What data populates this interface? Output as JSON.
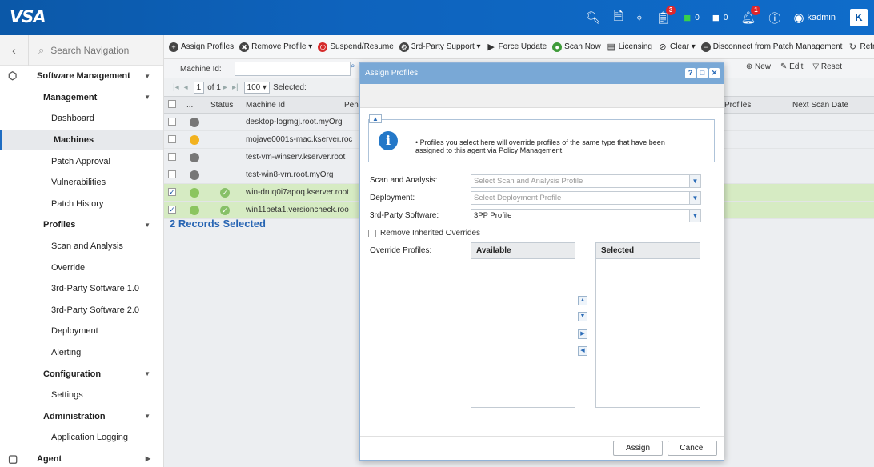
{
  "app": {
    "logo": "VSA",
    "notifications": {
      "tickets": "3",
      "alerts": "1"
    },
    "agents_online": "0",
    "agents_offline": "0",
    "user": "kadmin",
    "brand_letter": "K"
  },
  "sidebar": {
    "search_placeholder": "Search Navigation",
    "items": [
      {
        "label": "Software Management",
        "level": 0
      },
      {
        "label": "Management",
        "level": 1
      },
      {
        "label": "Dashboard",
        "level": 2
      },
      {
        "label": "Machines",
        "level": 2
      },
      {
        "label": "Patch Approval",
        "level": 2
      },
      {
        "label": "Vulnerabilities",
        "level": 2
      },
      {
        "label": "Patch History",
        "level": 2
      },
      {
        "label": "Profiles",
        "level": 1
      },
      {
        "label": "Scan and Analysis",
        "level": 2
      },
      {
        "label": "Override",
        "level": 2
      },
      {
        "label": "3rd-Party Software 1.0",
        "level": 2
      },
      {
        "label": "3rd-Party Software 2.0",
        "level": 2
      },
      {
        "label": "Deployment",
        "level": 2
      },
      {
        "label": "Alerting",
        "level": 2
      },
      {
        "label": "Configuration",
        "level": 1
      },
      {
        "label": "Settings",
        "level": 2
      },
      {
        "label": "Administration",
        "level": 1
      },
      {
        "label": "Application Logging",
        "level": 2
      },
      {
        "label": "Agent",
        "level": 0
      }
    ]
  },
  "toolbar": {
    "assign_profiles": "Assign Profiles",
    "remove_profile": "Remove Profile",
    "suspend_resume": "Suspend/Resume",
    "third_party_support": "3rd-Party Support",
    "force_update": "Force Update",
    "scan_now": "Scan Now",
    "licensing": "Licensing",
    "clear": "Clear",
    "disconnect": "Disconnect from Patch Management",
    "refresh": "Refresh"
  },
  "filter": {
    "machine_id_label": "Machine Id:",
    "new": "New",
    "edit": "Edit",
    "reset": "Reset"
  },
  "pager": {
    "page": "1",
    "of": "of 1",
    "page_size": "100",
    "selected_label": "Selected:"
  },
  "grid": {
    "headers": {
      "more": "...",
      "status": "Status",
      "machine_id": "Machine Id",
      "pending": "Pend",
      "profiles": "Profiles",
      "next_scan": "Next Scan Date"
    },
    "rows": [
      {
        "machine": "desktop-logmgj.root.myOrg",
        "checked": false,
        "status": "gray",
        "override": false
      },
      {
        "machine": "mojave0001s-mac.kserver.roc",
        "checked": false,
        "status": "yellow",
        "override": false
      },
      {
        "machine": "test-vm-winserv.kserver.root",
        "checked": false,
        "status": "gray",
        "override": false
      },
      {
        "machine": "test-win8-vm.root.myOrg",
        "checked": false,
        "status": "gray",
        "override": false
      },
      {
        "machine": "win-druq0i7apoq.kserver.root",
        "checked": true,
        "status": "green",
        "override": true
      },
      {
        "machine": "win11beta1.versioncheck.roo",
        "checked": true,
        "status": "green",
        "override": true
      }
    ],
    "records_selected": "2 Records Selected"
  },
  "modal": {
    "title": "Assign Profiles",
    "info": "Profiles you select here will override profiles of the same type that have been assigned to this agent via Policy Management.",
    "scan_label": "Scan and Analysis:",
    "scan_placeholder": "Select Scan and Analysis Profile",
    "deploy_label": "Deployment:",
    "deploy_placeholder": "Select Deployment Profile",
    "tps_label": "3rd-Party Software:",
    "tps_value": "3PP Profile",
    "remove_inherited": "Remove Inherited Overrides",
    "override_label": "Override Profiles:",
    "available": "Available",
    "selected": "Selected",
    "assign": "Assign",
    "cancel": "Cancel"
  }
}
